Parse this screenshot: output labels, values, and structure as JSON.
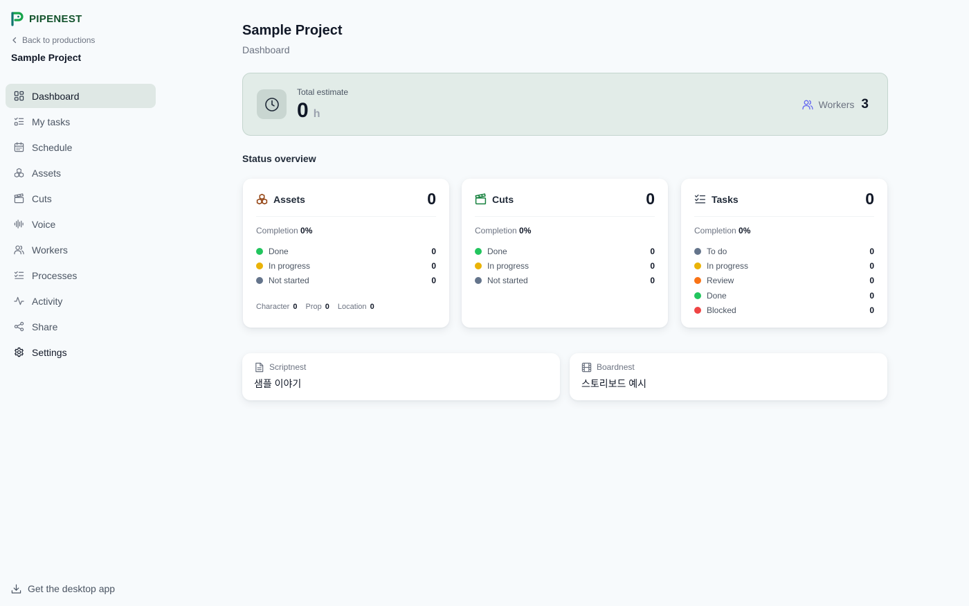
{
  "brand": {
    "name": "PIPENEST"
  },
  "sidebar": {
    "back_label": "Back to productions",
    "project_name": "Sample Project",
    "items": [
      {
        "label": "Dashboard",
        "icon": "dashboard-icon"
      },
      {
        "label": "My tasks",
        "icon": "list-check-icon"
      },
      {
        "label": "Schedule",
        "icon": "calendar-icon"
      },
      {
        "label": "Assets",
        "icon": "boxes-icon"
      },
      {
        "label": "Cuts",
        "icon": "clapperboard-icon"
      },
      {
        "label": "Voice",
        "icon": "audio-wave-icon"
      },
      {
        "label": "Workers",
        "icon": "users-icon"
      },
      {
        "label": "Processes",
        "icon": "list-todo-icon"
      },
      {
        "label": "Activity",
        "icon": "activity-icon"
      },
      {
        "label": "Share",
        "icon": "share-icon"
      },
      {
        "label": "Settings",
        "icon": "gear-icon"
      }
    ],
    "desktop_app_label": "Get the desktop app"
  },
  "header": {
    "title": "Sample Project",
    "subtitle": "Dashboard"
  },
  "estimate": {
    "label": "Total estimate",
    "value": "0",
    "unit": "h",
    "workers_label": "Workers",
    "workers_count": "3"
  },
  "status_overview": {
    "title": "Status overview",
    "completion_label": "Completion",
    "cards": {
      "assets": {
        "title": "Assets",
        "total": "0",
        "completion": "0%",
        "rows": [
          {
            "label": "Done",
            "count": "0",
            "color": "#22c55e"
          },
          {
            "label": "In progress",
            "count": "0",
            "color": "#eab308"
          },
          {
            "label": "Not started",
            "count": "0",
            "color": "#64748b"
          }
        ],
        "types": [
          {
            "label": "Character",
            "count": "0"
          },
          {
            "label": "Prop",
            "count": "0"
          },
          {
            "label": "Location",
            "count": "0"
          }
        ]
      },
      "cuts": {
        "title": "Cuts",
        "total": "0",
        "completion": "0%",
        "rows": [
          {
            "label": "Done",
            "count": "0",
            "color": "#22c55e"
          },
          {
            "label": "In progress",
            "count": "0",
            "color": "#eab308"
          },
          {
            "label": "Not started",
            "count": "0",
            "color": "#64748b"
          }
        ]
      },
      "tasks": {
        "title": "Tasks",
        "total": "0",
        "completion": "0%",
        "rows": [
          {
            "label": "To do",
            "count": "0",
            "color": "#64748b"
          },
          {
            "label": "In progress",
            "count": "0",
            "color": "#eab308"
          },
          {
            "label": "Review",
            "count": "0",
            "color": "#f97316"
          },
          {
            "label": "Done",
            "count": "0",
            "color": "#22c55e"
          },
          {
            "label": "Blocked",
            "count": "0",
            "color": "#ef4444"
          }
        ]
      }
    }
  },
  "links": {
    "scriptnest": {
      "app": "Scriptnest",
      "title": "샘플 이야기"
    },
    "boardnest": {
      "app": "Boardnest",
      "title": "스토리보드 예시"
    }
  },
  "colors": {
    "brand": "#14532d",
    "logo": "#16a34a",
    "estimate_bg": "#e2ece8",
    "nav_active_bg": "#dfe8e5",
    "assets_icon": "#92400e",
    "cuts_icon": "#15803d",
    "workers_icon": "#6366f1"
  }
}
